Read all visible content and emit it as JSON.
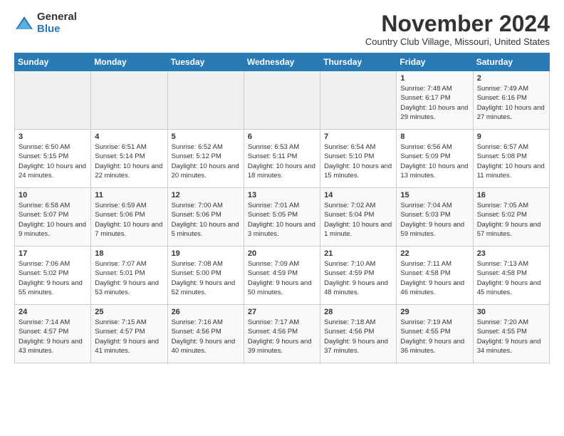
{
  "logo": {
    "general": "General",
    "blue": "Blue"
  },
  "header": {
    "month": "November 2024",
    "location": "Country Club Village, Missouri, United States"
  },
  "weekdays": [
    "Sunday",
    "Monday",
    "Tuesday",
    "Wednesday",
    "Thursday",
    "Friday",
    "Saturday"
  ],
  "weeks": [
    [
      {
        "day": "",
        "info": ""
      },
      {
        "day": "",
        "info": ""
      },
      {
        "day": "",
        "info": ""
      },
      {
        "day": "",
        "info": ""
      },
      {
        "day": "",
        "info": ""
      },
      {
        "day": "1",
        "info": "Sunrise: 7:48 AM\nSunset: 6:17 PM\nDaylight: 10 hours and 29 minutes."
      },
      {
        "day": "2",
        "info": "Sunrise: 7:49 AM\nSunset: 6:16 PM\nDaylight: 10 hours and 27 minutes."
      }
    ],
    [
      {
        "day": "3",
        "info": "Sunrise: 6:50 AM\nSunset: 5:15 PM\nDaylight: 10 hours and 24 minutes."
      },
      {
        "day": "4",
        "info": "Sunrise: 6:51 AM\nSunset: 5:14 PM\nDaylight: 10 hours and 22 minutes."
      },
      {
        "day": "5",
        "info": "Sunrise: 6:52 AM\nSunset: 5:12 PM\nDaylight: 10 hours and 20 minutes."
      },
      {
        "day": "6",
        "info": "Sunrise: 6:53 AM\nSunset: 5:11 PM\nDaylight: 10 hours and 18 minutes."
      },
      {
        "day": "7",
        "info": "Sunrise: 6:54 AM\nSunset: 5:10 PM\nDaylight: 10 hours and 15 minutes."
      },
      {
        "day": "8",
        "info": "Sunrise: 6:56 AM\nSunset: 5:09 PM\nDaylight: 10 hours and 13 minutes."
      },
      {
        "day": "9",
        "info": "Sunrise: 6:57 AM\nSunset: 5:08 PM\nDaylight: 10 hours and 11 minutes."
      }
    ],
    [
      {
        "day": "10",
        "info": "Sunrise: 6:58 AM\nSunset: 5:07 PM\nDaylight: 10 hours and 9 minutes."
      },
      {
        "day": "11",
        "info": "Sunrise: 6:59 AM\nSunset: 5:06 PM\nDaylight: 10 hours and 7 minutes."
      },
      {
        "day": "12",
        "info": "Sunrise: 7:00 AM\nSunset: 5:06 PM\nDaylight: 10 hours and 5 minutes."
      },
      {
        "day": "13",
        "info": "Sunrise: 7:01 AM\nSunset: 5:05 PM\nDaylight: 10 hours and 3 minutes."
      },
      {
        "day": "14",
        "info": "Sunrise: 7:02 AM\nSunset: 5:04 PM\nDaylight: 10 hours and 1 minute."
      },
      {
        "day": "15",
        "info": "Sunrise: 7:04 AM\nSunset: 5:03 PM\nDaylight: 9 hours and 59 minutes."
      },
      {
        "day": "16",
        "info": "Sunrise: 7:05 AM\nSunset: 5:02 PM\nDaylight: 9 hours and 57 minutes."
      }
    ],
    [
      {
        "day": "17",
        "info": "Sunrise: 7:06 AM\nSunset: 5:02 PM\nDaylight: 9 hours and 55 minutes."
      },
      {
        "day": "18",
        "info": "Sunrise: 7:07 AM\nSunset: 5:01 PM\nDaylight: 9 hours and 53 minutes."
      },
      {
        "day": "19",
        "info": "Sunrise: 7:08 AM\nSunset: 5:00 PM\nDaylight: 9 hours and 52 minutes."
      },
      {
        "day": "20",
        "info": "Sunrise: 7:09 AM\nSunset: 4:59 PM\nDaylight: 9 hours and 50 minutes."
      },
      {
        "day": "21",
        "info": "Sunrise: 7:10 AM\nSunset: 4:59 PM\nDaylight: 9 hours and 48 minutes."
      },
      {
        "day": "22",
        "info": "Sunrise: 7:11 AM\nSunset: 4:58 PM\nDaylight: 9 hours and 46 minutes."
      },
      {
        "day": "23",
        "info": "Sunrise: 7:13 AM\nSunset: 4:58 PM\nDaylight: 9 hours and 45 minutes."
      }
    ],
    [
      {
        "day": "24",
        "info": "Sunrise: 7:14 AM\nSunset: 4:57 PM\nDaylight: 9 hours and 43 minutes."
      },
      {
        "day": "25",
        "info": "Sunrise: 7:15 AM\nSunset: 4:57 PM\nDaylight: 9 hours and 41 minutes."
      },
      {
        "day": "26",
        "info": "Sunrise: 7:16 AM\nSunset: 4:56 PM\nDaylight: 9 hours and 40 minutes."
      },
      {
        "day": "27",
        "info": "Sunrise: 7:17 AM\nSunset: 4:56 PM\nDaylight: 9 hours and 39 minutes."
      },
      {
        "day": "28",
        "info": "Sunrise: 7:18 AM\nSunset: 4:56 PM\nDaylight: 9 hours and 37 minutes."
      },
      {
        "day": "29",
        "info": "Sunrise: 7:19 AM\nSunset: 4:55 PM\nDaylight: 9 hours and 36 minutes."
      },
      {
        "day": "30",
        "info": "Sunrise: 7:20 AM\nSunset: 4:55 PM\nDaylight: 9 hours and 34 minutes."
      }
    ]
  ]
}
